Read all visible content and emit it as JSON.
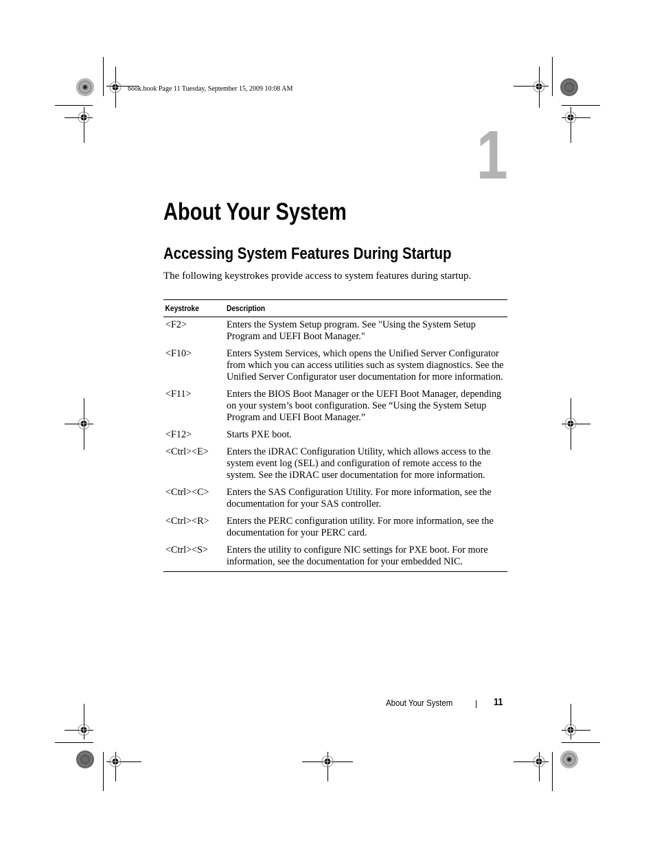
{
  "slug": {
    "text": "book.book  Page 11  Tuesday, September 15, 2009  10:08 AM"
  },
  "chapter": {
    "number": "1",
    "title": "About Your System"
  },
  "section": {
    "heading": "Accessing System Features During Startup",
    "intro": "The following keystrokes provide access to system features during startup."
  },
  "table": {
    "headers": [
      "Keystroke",
      "Description"
    ],
    "rows": [
      {
        "key": "<F2>",
        "desc": "Enters the System Setup program. See \"Using the System Setup Program and UEFI Boot Manager.\""
      },
      {
        "key": "<F10>",
        "desc": "Enters System Services, which opens the Unified Server Configurator from which you can access utilities such as system diagnostics. See the Unified Server Configurator user documentation for more information."
      },
      {
        "key": "<F11>",
        "desc": "Enters the BIOS Boot Manager or the UEFI Boot Manager, depending on your system’s boot configuration. See “Using the System Setup Program and UEFI Boot Manager.”"
      },
      {
        "key": "<F12>",
        "desc": "Starts PXE boot."
      },
      {
        "key": "<Ctrl><E>",
        "desc": "Enters the iDRAC Configuration Utility, which allows access to the system event log (SEL) and configuration of remote access to the system. See the iDRAC user documentation for more information."
      },
      {
        "key": "<Ctrl><C>",
        "desc": "Enters the SAS Configuration Utility. For more information, see the documentation for your SAS controller."
      },
      {
        "key": "<Ctrl><R>",
        "desc": "Enters the PERC configuration utility. For more information, see the documentation for your PERC card."
      },
      {
        "key": "<Ctrl><S>",
        "desc": "Enters the utility to configure NIC settings for PXE boot. For more information, see the documentation for your embedded NIC."
      }
    ]
  },
  "footer": {
    "section_title": "About Your System",
    "page_number": "11"
  },
  "colors": {
    "chapter_number": "#b3b3b3",
    "text": "#000000"
  }
}
